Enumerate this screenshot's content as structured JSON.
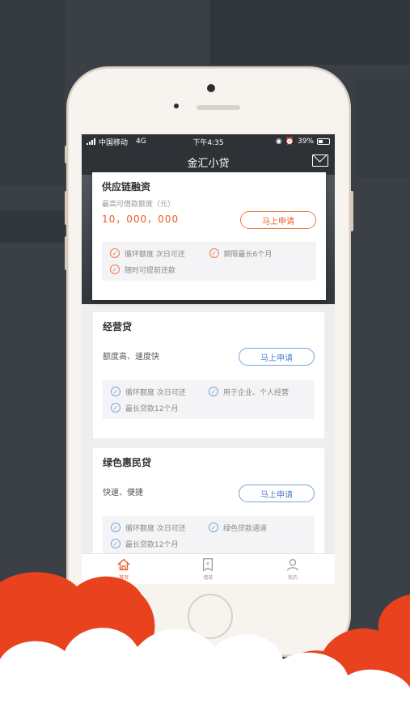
{
  "colors": {
    "accent_orange": "#f05a28",
    "accent_blue": "#4a7fc8",
    "background": "#3a4046",
    "cloud_red": "#e8421f"
  },
  "status_bar": {
    "carrier": "中国移动",
    "network": "4G",
    "time": "下午4:35",
    "battery": "39%"
  },
  "nav": {
    "title": "金汇小贷",
    "right_icon": "mail-icon"
  },
  "loans": [
    {
      "title": "供应链融资",
      "subtitle": "最高可借款额度（元）",
      "amount": "10，000，000",
      "apply_label": "马上申请",
      "features": [
        "循环额度 次日可还",
        "期限最长6个月",
        "随时可提前还款"
      ]
    },
    {
      "title": "经营贷",
      "description": "额度高、速度快",
      "apply_label": "马上申请",
      "features": [
        "循环额度 次日可还",
        "用于企业、个人经营",
        "最长贷款12个月"
      ]
    },
    {
      "title": "绿色惠民贷",
      "description": "快速、便捷",
      "apply_label": "马上申请",
      "features": [
        "循环额度 次日可还",
        "绿色贷款通道",
        "最长贷款12个月"
      ]
    }
  ],
  "tabbar": {
    "items": [
      {
        "label": "首页",
        "icon": "home-icon",
        "active": true
      },
      {
        "label": "借款",
        "icon": "loan-icon",
        "active": false
      },
      {
        "label": "我的",
        "icon": "user-icon",
        "active": false
      }
    ]
  }
}
